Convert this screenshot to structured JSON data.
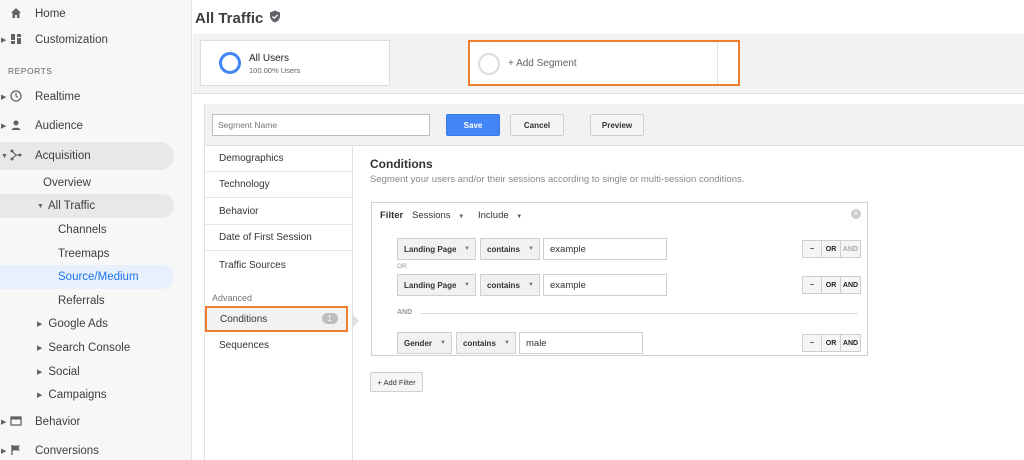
{
  "sidebar": {
    "home": "Home",
    "customization": "Customization",
    "reports_label": "REPORTS",
    "realtime": "Realtime",
    "audience": "Audience",
    "acquisition": "Acquisition",
    "overview": "Overview",
    "all_traffic": "All Traffic",
    "channels": "Channels",
    "treemaps": "Treemaps",
    "source_medium": "Source/Medium",
    "referrals": "Referrals",
    "google_ads": "Google Ads",
    "search_console": "Search Console",
    "social": "Social",
    "campaigns": "Campaigns",
    "behavior": "Behavior",
    "conversions": "Conversions"
  },
  "header": {
    "title": "All Traffic"
  },
  "segments": {
    "all_users_name": "All Users",
    "all_users_pct": "100.00% Users",
    "add_segment": "+ Add Segment"
  },
  "editor": {
    "segment_name_placeholder": "Segment Name",
    "save": "Save",
    "cancel": "Cancel",
    "preview": "Preview",
    "menu": {
      "demographics": "Demographics",
      "technology": "Technology",
      "behavior": "Behavior",
      "date_first_session": "Date of First Session",
      "traffic_sources": "Traffic Sources",
      "advanced": "Advanced",
      "conditions": "Conditions",
      "conditions_count": "1",
      "sequences": "Sequences"
    },
    "conditions": {
      "title": "Conditions",
      "subtitle": "Segment your users and/or their sessions according to single or multi-session conditions.",
      "filter_label": "Filter",
      "scope": "Sessions",
      "mode": "Include",
      "or_sep": "OR",
      "and_sep": "AND",
      "rows": [
        {
          "dimension": "Landing Page",
          "operator": "contains",
          "value": "example"
        },
        {
          "dimension": "Landing Page",
          "operator": "contains",
          "value": "example"
        },
        {
          "dimension": "Gender",
          "operator": "contains",
          "value": "male"
        }
      ],
      "minus": "−",
      "or": "OR",
      "and": "AND",
      "add_filter": "+ Add Filter"
    }
  },
  "colors": {
    "accent": "#4285f4",
    "highlight": "#ee7d33",
    "selected_bg": "#e8f0fe"
  }
}
